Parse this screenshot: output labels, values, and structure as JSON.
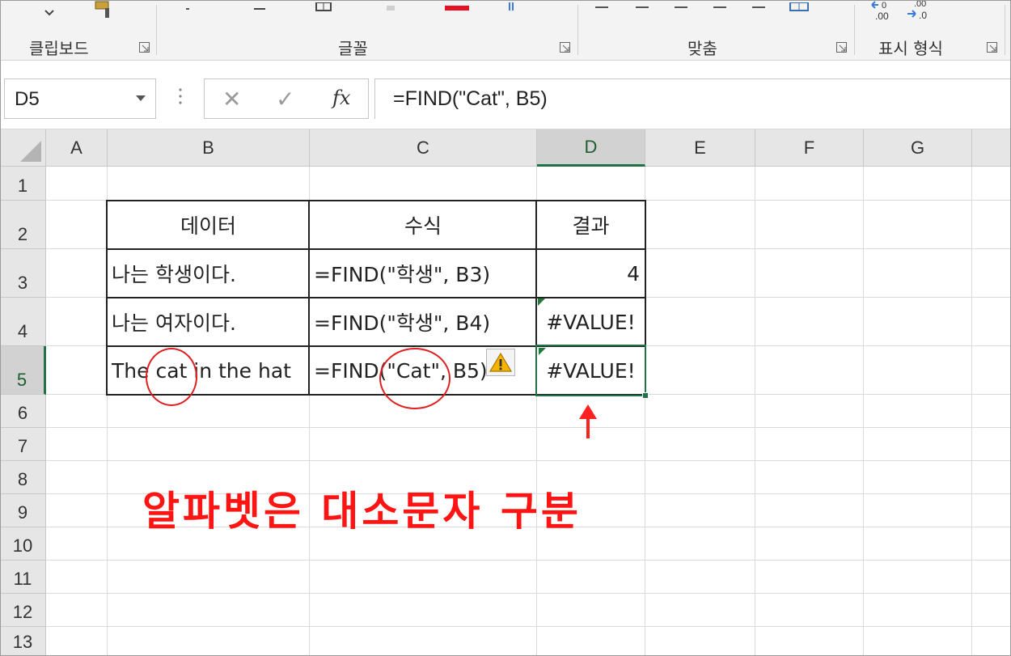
{
  "ribbon": {
    "groups": [
      {
        "label": "클립보드"
      },
      {
        "label": "글꼴"
      },
      {
        "label": "맞춤"
      },
      {
        "label": "표시 형식"
      }
    ],
    "accent_color": "#217346",
    "font_color_swatch": "#e81123"
  },
  "formula_bar": {
    "name_box": "D5",
    "cancel_symbol": "✕",
    "enter_symbol": "✓",
    "fx_label": "fx",
    "formula": "=FIND(\"Cat\", B5)"
  },
  "columns": [
    "A",
    "B",
    "C",
    "D",
    "E",
    "F",
    "G"
  ],
  "rows": [
    "1",
    "2",
    "3",
    "4",
    "5",
    "6",
    "7",
    "8",
    "9",
    "10",
    "11",
    "12",
    "13"
  ],
  "selected_cell": {
    "column": "D",
    "row": "5"
  },
  "table": {
    "headers": [
      "데이터",
      "수식",
      "결과"
    ],
    "rows": [
      {
        "data": "나는 학생이다.",
        "formula": "=FIND(\"학생\", B3)",
        "result": "4"
      },
      {
        "data": "나는 여자이다.",
        "formula": "=FIND(\"학생\", B4)",
        "result": "#VALUE!"
      },
      {
        "data": "The cat in the hat",
        "formula": "=FIND(\"Cat\", B5)",
        "result": "#VALUE!"
      }
    ]
  },
  "annotation": {
    "text": "알파벳은 대소문자 구분",
    "color": "#ff1414"
  }
}
